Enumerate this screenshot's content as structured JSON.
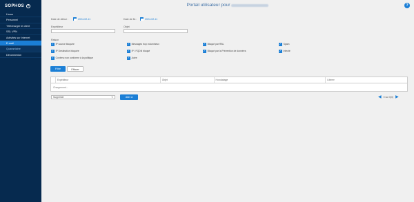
{
  "brand": {
    "logo": "SOPHOS"
  },
  "sidebar": {
    "items": [
      {
        "label": "Home",
        "state": "normal"
      },
      {
        "label": "Personnel",
        "state": "normal"
      },
      {
        "label": "Télécharger le client",
        "state": "normal"
      },
      {
        "label": "SSL VPN",
        "state": "normal"
      },
      {
        "label": "Activités sur Internet",
        "state": "normal"
      },
      {
        "label": "E-mail",
        "state": "active"
      },
      {
        "label": "Quarantaine",
        "state": "sub"
      },
      {
        "label": "Déconnexion",
        "state": "normal"
      }
    ]
  },
  "header": {
    "title": "Portail utilisateur pour",
    "help": "?"
  },
  "filters": {
    "start_date_label": "Date de début :",
    "start_date_value": "2024-02-11",
    "end_date_label": "Date de fin :",
    "end_date_value": "2024-02-11",
    "sender_label": "Expéditeur",
    "sender_value": "",
    "subject_label": "Objet",
    "subject_value": ""
  },
  "reason": {
    "title": "Raison",
    "options": [
      {
        "label": "IP source bloquée",
        "checked": true
      },
      {
        "label": "Messages trop volumineux",
        "checked": true
      },
      {
        "label": "Bloqué par RBL",
        "checked": true
      },
      {
        "label": "Spam",
        "checked": true
      },
      {
        "label": "IP Destination bloquée",
        "checked": true
      },
      {
        "label": "IP / FQDN bloqué",
        "checked": true
      },
      {
        "label": "Bloqué par la Prévention de données",
        "checked": true
      },
      {
        "label": "Infecté",
        "checked": true
      },
      {
        "label": "Contenu non conforme à la politique",
        "checked": true
      },
      {
        "label": "Autre",
        "checked": true
      }
    ]
  },
  "actions": {
    "filter": "Filtre",
    "clear": "Effacer"
  },
  "table": {
    "headers": [
      "",
      "Expéditeur",
      "Objet",
      "Horodatage",
      "Libérer"
    ],
    "loading": "Chargement..."
  },
  "bulk": {
    "select_value": "Supprimer",
    "go": "Aller à"
  },
  "pagination": {
    "text": "0 sur 0(0)",
    "prev": "◀",
    "next": "▶"
  },
  "colors": {
    "sidebar": "#062a4f",
    "accent": "#1b7fd6",
    "active_item": "#1b7fd6"
  }
}
